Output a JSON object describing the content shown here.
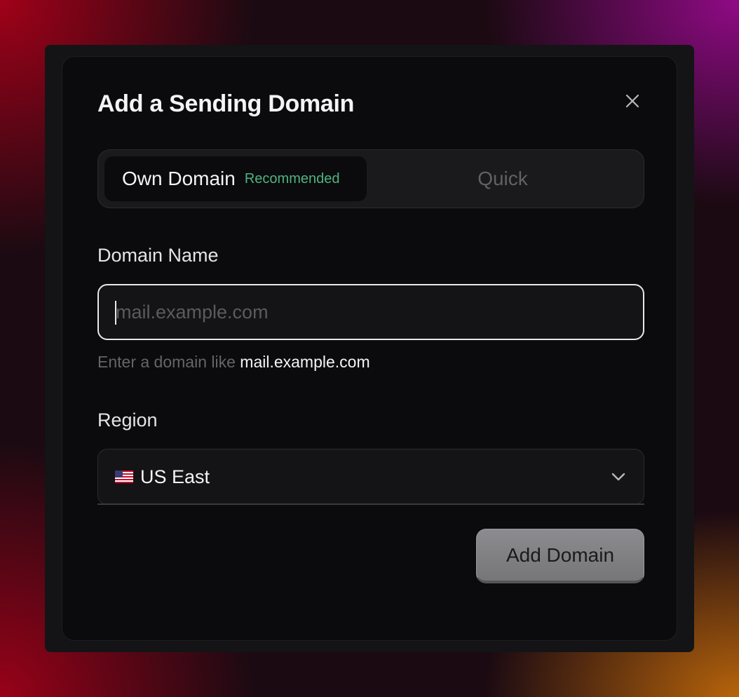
{
  "dialog": {
    "title": "Add a Sending Domain",
    "close_icon": "close-icon"
  },
  "tabs": {
    "own_domain": {
      "label": "Own Domain",
      "badge": "Recommended",
      "badge_color": "#4fb381",
      "selected": true
    },
    "quick": {
      "label": "Quick",
      "selected": false
    }
  },
  "domain": {
    "label": "Domain Name",
    "value": "",
    "placeholder": "mail.example.com",
    "hint_prefix": "Enter a domain like",
    "hint_example": "mail.example.com"
  },
  "region": {
    "label": "Region",
    "selected": "US East",
    "flag_icon": "us-flag-icon",
    "chevron_icon": "chevron-down-icon"
  },
  "actions": {
    "submit_label": "Add Domain"
  }
}
